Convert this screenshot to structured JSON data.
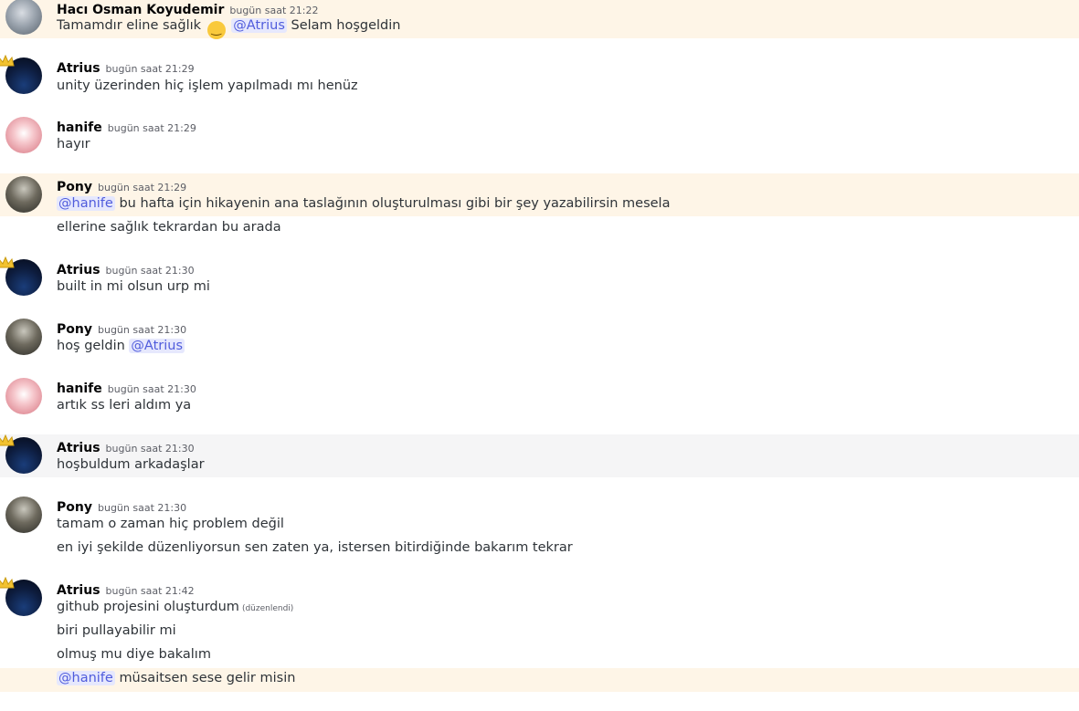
{
  "users": {
    "haci": "Hacı Osman Koyudemir",
    "atrius": "Atrius",
    "hanife": "hanife",
    "pony": "Pony"
  },
  "messages": [
    {
      "user": "Hacı Osman Koyudemir",
      "time": "bugün saat 21:22",
      "lines": [
        {
          "pre": "Tamamdır eline  sağlık",
          "emoji": "🙂",
          "mention": "@Atrius",
          "post": "Selam hoşgeldin"
        }
      ]
    },
    {
      "user": "Atrius",
      "time": "bugün saat 21:29",
      "lines": [
        {
          "text": "unity üzerinden hiç işlem yapılmadı mı henüz"
        }
      ]
    },
    {
      "user": "hanife",
      "time": "bugün saat 21:29",
      "lines": [
        {
          "text": "hayır"
        }
      ]
    },
    {
      "user": "Pony",
      "time": "bugün saat 21:29",
      "lines": [
        {
          "mention": "@hanife",
          "post": "bu hafta için hikayenin ana taslağının oluşturulması gibi bir şey yazabilirsin mesela"
        },
        {
          "text": "ellerine sağlık tekrardan bu arada"
        }
      ]
    },
    {
      "user": "Atrius",
      "time": "bugün saat 21:30",
      "lines": [
        {
          "text": "built in mi olsun urp mi"
        }
      ]
    },
    {
      "user": "Pony",
      "time": "bugün saat 21:30",
      "lines": [
        {
          "pre": "hoş geldin",
          "mention": "@Atrius"
        }
      ]
    },
    {
      "user": "hanife",
      "time": "bugün saat 21:30",
      "lines": [
        {
          "text": "artık ss leri aldım ya"
        }
      ]
    },
    {
      "user": "Atrius",
      "time": "bugün saat 21:30",
      "lines": [
        {
          "text": "hoşbuldum arkadaşlar"
        }
      ]
    },
    {
      "user": "Pony",
      "time": "bugün saat 21:30",
      "lines": [
        {
          "text": "tamam o zaman hiç problem değil"
        },
        {
          "text": "en iyi şekilde düzenliyorsun sen zaten ya, istersen bitirdiğinde bakarım tekrar"
        }
      ]
    },
    {
      "user": "Atrius",
      "time": "bugün saat 21:42",
      "lines": [
        {
          "text": "github projesini oluşturdum",
          "edited": "(düzenlendi)"
        },
        {
          "text": "biri pullayabilir mi"
        },
        {
          "text": "olmuş mu diye bakalım"
        },
        {
          "mention": "@hanife",
          "post": "müsaitsen sese gelir misin"
        }
      ]
    }
  ]
}
